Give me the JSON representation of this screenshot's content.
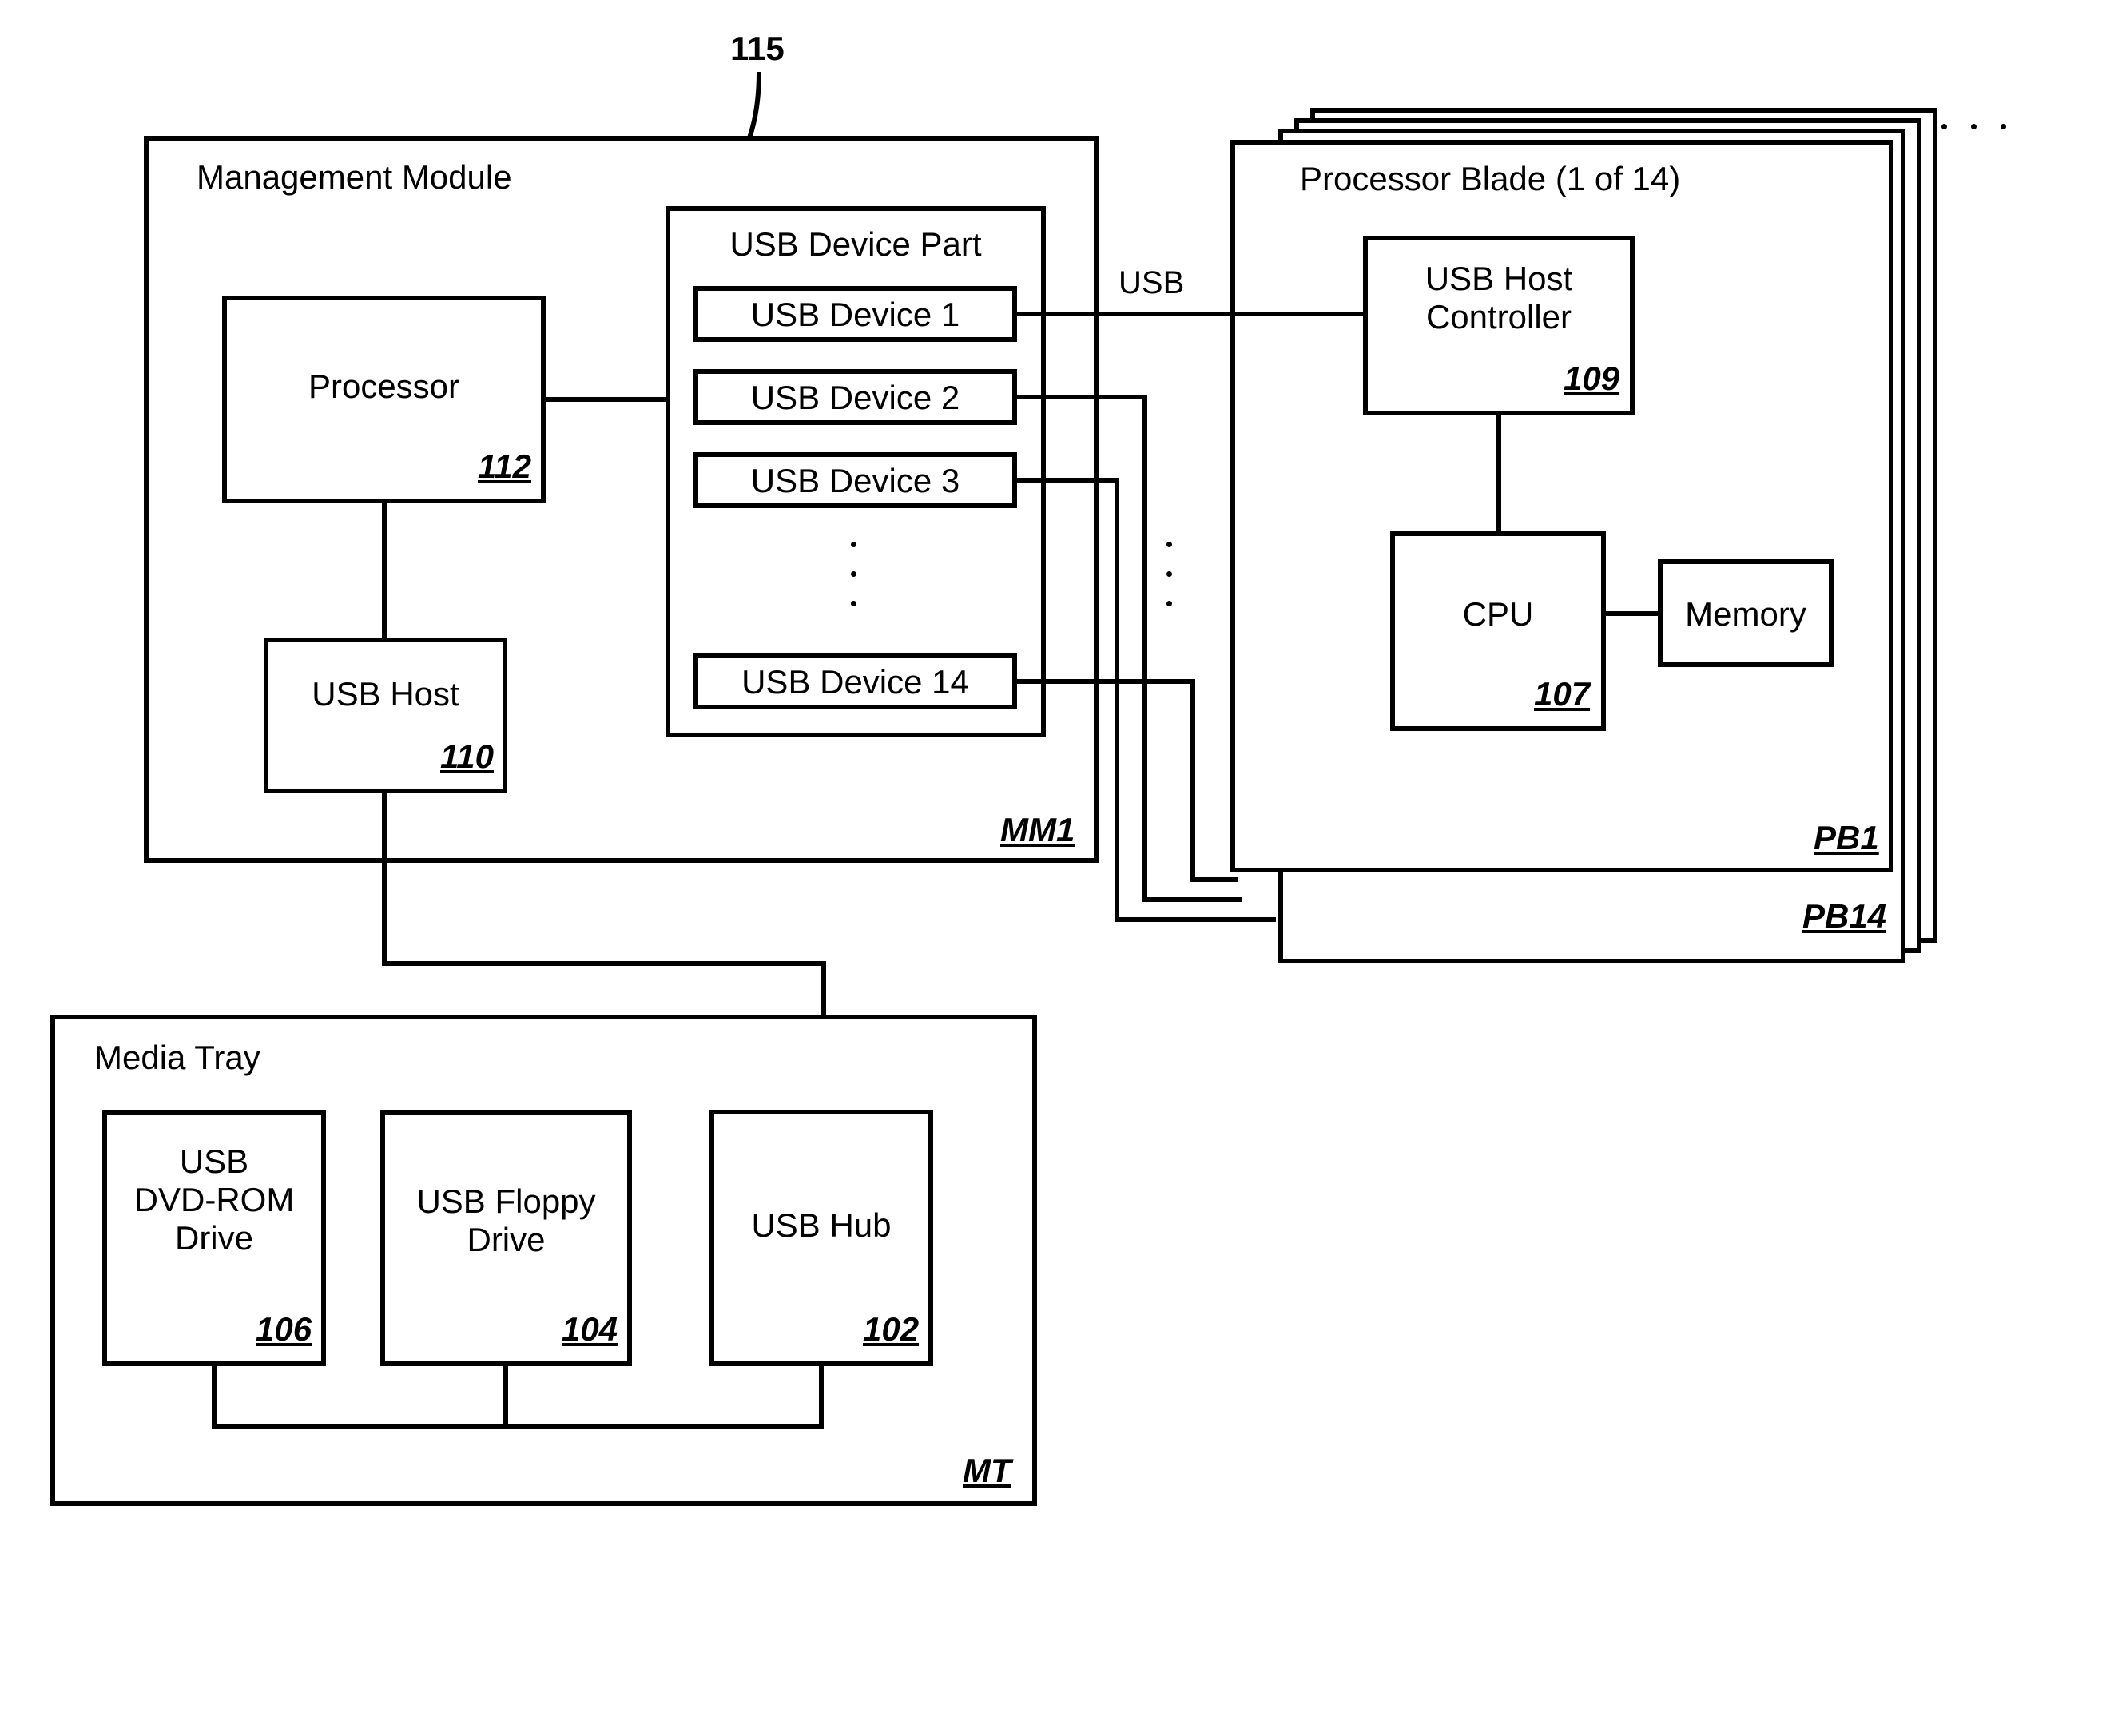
{
  "top_ref": "115",
  "management_module": {
    "title": "Management Module",
    "tag": "MM1",
    "processor": {
      "label": "Processor",
      "ref": "112"
    },
    "usb_host": {
      "label": "USB Host",
      "ref": "110"
    },
    "usb_device_part": {
      "title": "USB Device Part",
      "dev1": "USB Device 1",
      "dev2": "USB Device 2",
      "dev3": "USB Device 3",
      "dev14": "USB Device 14"
    }
  },
  "bus_label": "USB",
  "processor_blade": {
    "title": "Processor Blade (1 of 14)",
    "tag_front": "PB1",
    "tag_back": "PB14",
    "usb_host_controller": {
      "label": "USB Host\nController",
      "ref": "109"
    },
    "cpu": {
      "label": "CPU",
      "ref": "107"
    },
    "memory": "Memory"
  },
  "media_tray": {
    "title": "Media Tray",
    "tag": "MT",
    "dvd": {
      "label": "USB\nDVD-ROM\nDrive",
      "ref": "106"
    },
    "floppy": {
      "label": "USB Floppy\nDrive",
      "ref": "104"
    },
    "hub": {
      "label": "USB Hub",
      "ref": "102"
    }
  }
}
